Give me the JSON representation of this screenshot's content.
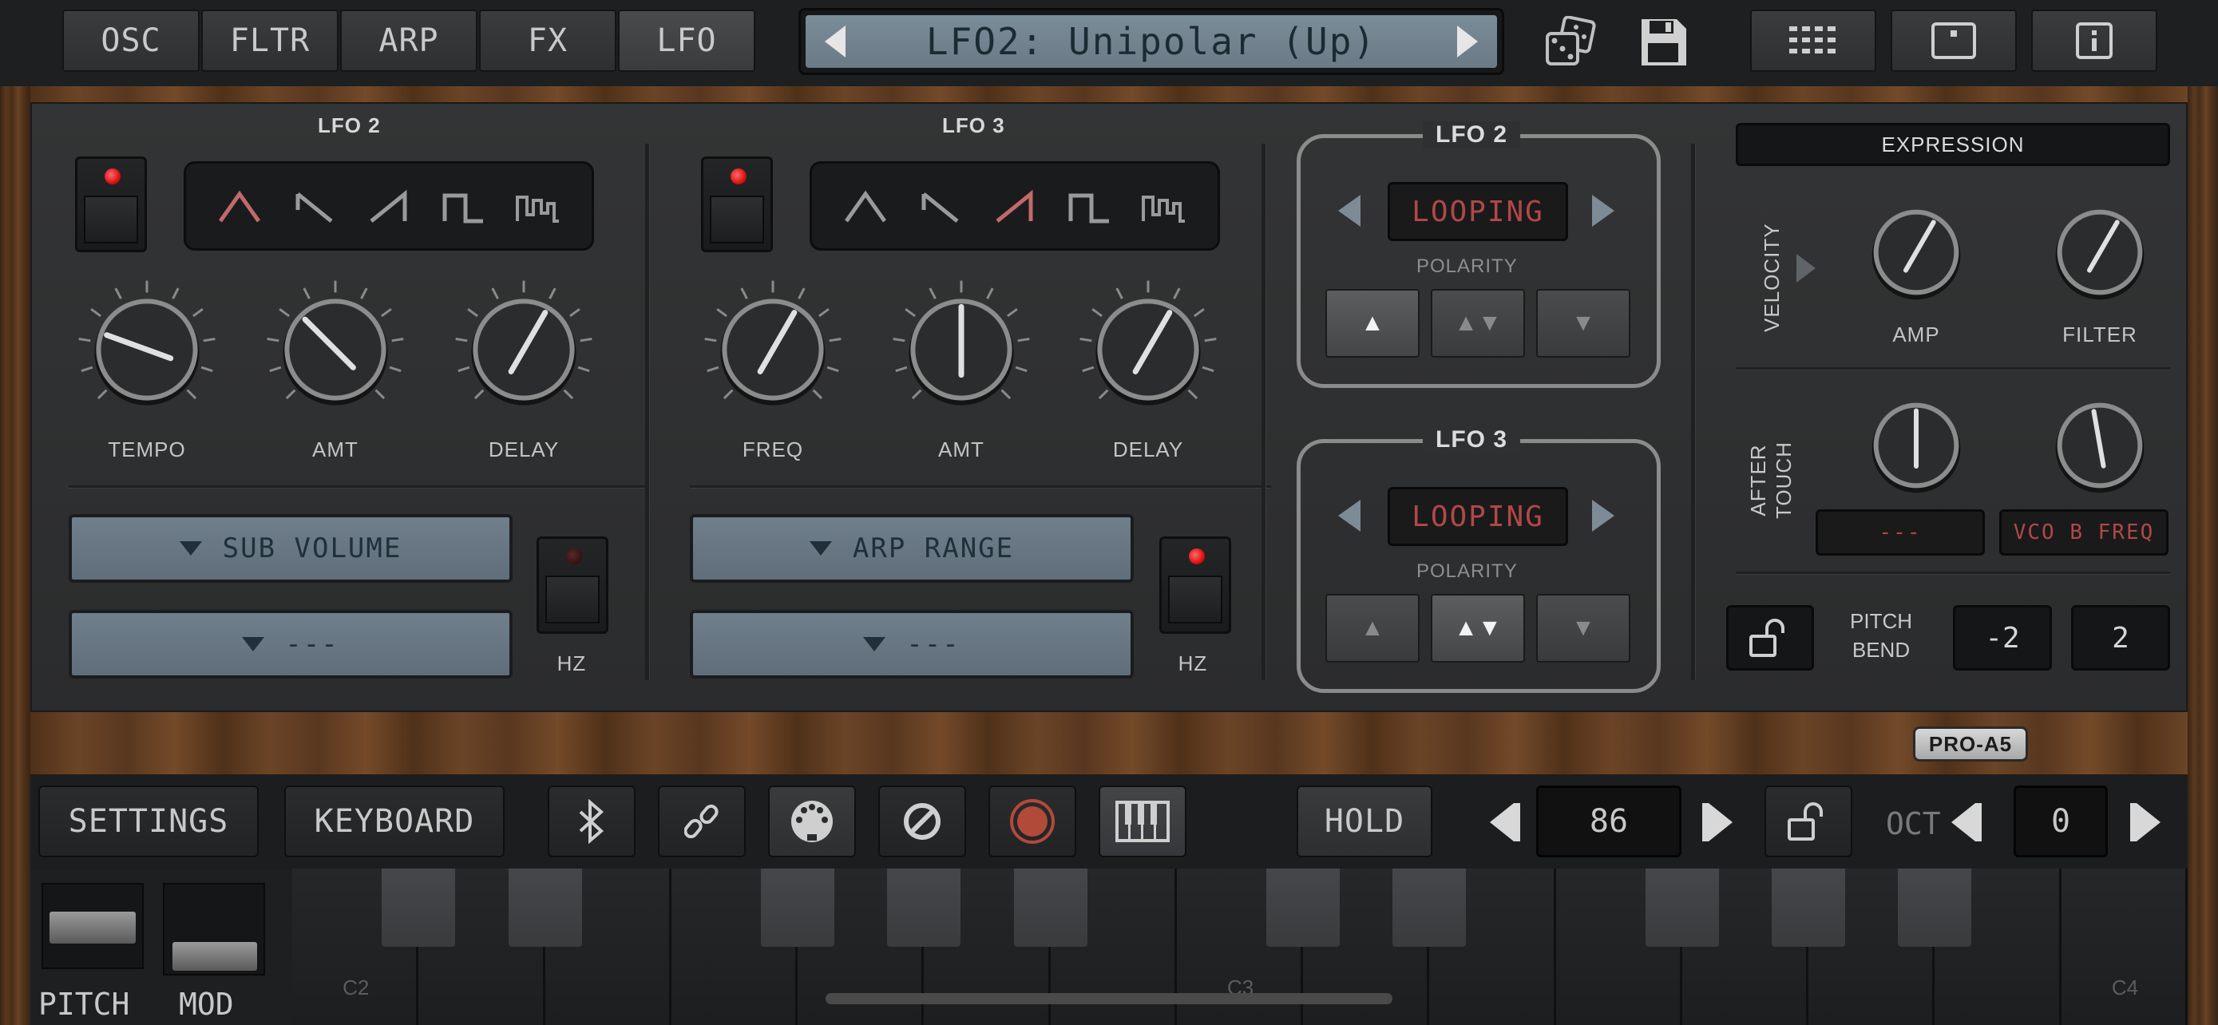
{
  "topbar": {
    "tabs": [
      "OSC",
      "FLTR",
      "ARP",
      "FX",
      "LFO"
    ],
    "active_tab": "LFO",
    "preset_name": "LFO2: Unipolar (Up)",
    "right_icons": [
      "dice-icon",
      "save-icon",
      "grid-icon",
      "square-dot-icon",
      "info-icon"
    ]
  },
  "lfo2": {
    "title": "LFO 2",
    "waves": [
      "triangle",
      "saw-down",
      "saw-up",
      "square",
      "random"
    ],
    "active_wave": 0,
    "knobs": [
      {
        "label": "TEMPO",
        "angle": -70
      },
      {
        "label": "AMT",
        "angle": -45
      },
      {
        "label": "DELAY",
        "angle": 30
      }
    ],
    "dest1": "SUB VOLUME",
    "dest2": "---",
    "hz_label": "HZ",
    "led_on": true,
    "hz_led_on": false
  },
  "lfo3": {
    "title": "LFO 3",
    "waves": [
      "triangle",
      "saw-down",
      "saw-up",
      "square",
      "random"
    ],
    "active_wave": 2,
    "knobs": [
      {
        "label": "FREQ",
        "angle": 30
      },
      {
        "label": "AMT",
        "angle": 0
      },
      {
        "label": "DELAY",
        "angle": 30
      }
    ],
    "dest1": "ARP RANGE",
    "dest2": "---",
    "hz_label": "HZ",
    "led_on": true,
    "hz_led_on": true
  },
  "lfo2_mode": {
    "title": "LFO 2",
    "mode": "LOOPING",
    "polarity_label": "POLARITY",
    "active_polarity": 0
  },
  "lfo3_mode": {
    "title": "LFO 3",
    "mode": "LOOPING",
    "polarity_label": "POLARITY",
    "active_polarity": 1
  },
  "expression": {
    "title": "EXPRESSION",
    "velocity_label": "VELOCITY",
    "amp_label": "AMP",
    "filter_label": "FILTER",
    "aftertouch_label": "AFTER TOUCH",
    "aftertouch_dest1": "---",
    "aftertouch_dest2": "VCO B FREQ",
    "pitch_bend_label_1": "PITCH",
    "pitch_bend_label_2": "BEND",
    "pitch_bend_down": "-2",
    "pitch_bend_up": "2"
  },
  "brand": "PRO-A5",
  "bottombar": {
    "settings": "SETTINGS",
    "keyboard": "KEYBOARD",
    "hold": "HOLD",
    "velocity_value": "86",
    "oct_label": "OCT",
    "oct_value": "0"
  },
  "keyboard": {
    "labels": [
      "C2",
      "C3",
      "C4"
    ],
    "pitch_label": "PITCH",
    "mod_label": "MOD"
  },
  "colors": {
    "accent_red": "#b04848",
    "lcd_blue": "#7b8c99",
    "wood": "#5b3920"
  }
}
